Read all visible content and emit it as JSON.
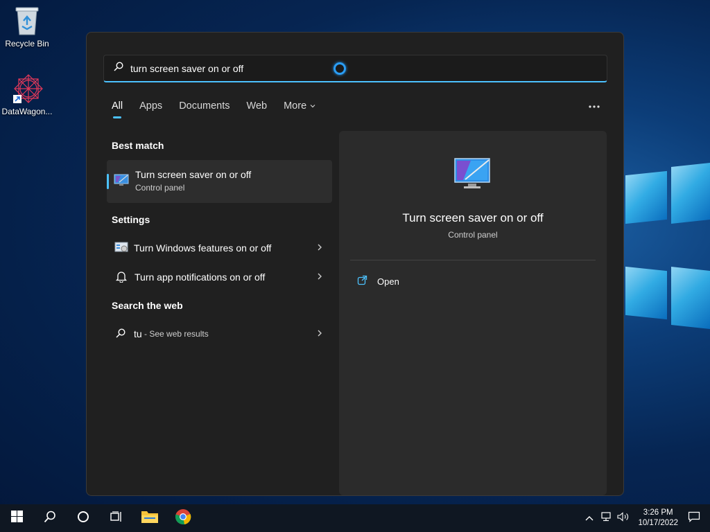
{
  "desktop": {
    "icons": [
      {
        "label": "Recycle Bin",
        "icon": "recycle-bin-icon"
      },
      {
        "label": "DataWagon...",
        "icon": "datawagon-app-icon"
      }
    ]
  },
  "search": {
    "query": "turn screen saver on or off",
    "tabs": [
      "All",
      "Apps",
      "Documents",
      "Web",
      "More"
    ],
    "active_tab": "All"
  },
  "best_match": {
    "heading": "Best match",
    "title": "Turn screen saver on or off",
    "subtitle": "Control panel"
  },
  "settings": {
    "heading": "Settings",
    "items": [
      {
        "label": "Turn Windows features on or off",
        "icon": "windows-features-icon"
      },
      {
        "label": "Turn app notifications on or off",
        "icon": "bell-icon"
      }
    ]
  },
  "web": {
    "heading": "Search the web",
    "query": "tu",
    "suffix": " - See web results"
  },
  "detail": {
    "title": "Turn screen saver on or off",
    "subtitle": "Control panel",
    "actions": [
      {
        "label": "Open",
        "icon": "open-external-icon"
      }
    ]
  },
  "taskbar": {
    "time": "3:26 PM",
    "date": "10/17/2022"
  },
  "colors": {
    "accent": "#4cc2ff",
    "panel_bg": "#202020",
    "detail_bg": "#2b2b2b"
  }
}
